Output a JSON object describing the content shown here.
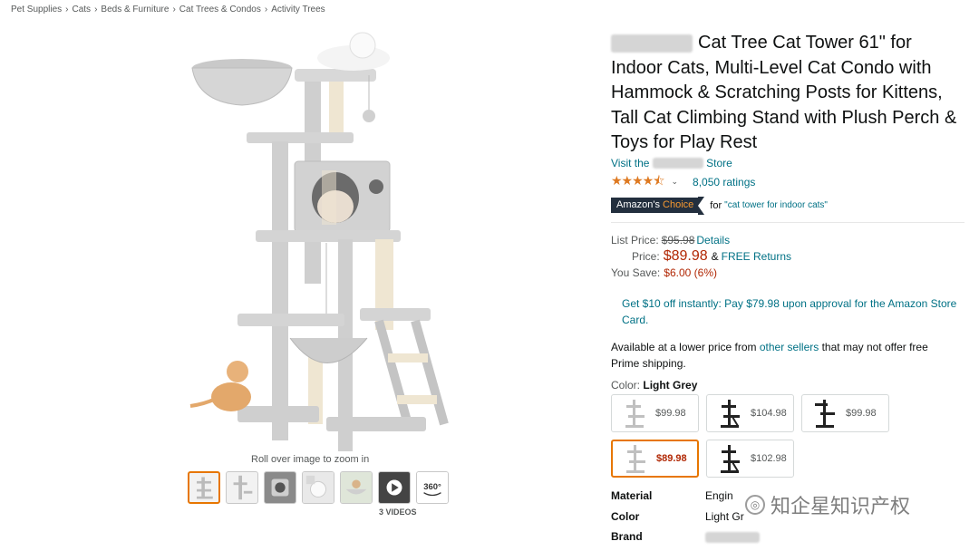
{
  "breadcrumb": [
    "Pet Supplies",
    "Cats",
    "Beds & Furniture",
    "Cat Trees & Condos",
    "Activity Trees"
  ],
  "breadcrumb_sep": "›",
  "gallery": {
    "zoom_hint": "Roll over image to zoom in",
    "videos_label": "3 VIDEOS",
    "thumb_360_label": "360°",
    "thumbnails": [
      "image-1",
      "image-2",
      "image-3",
      "image-4",
      "image-5",
      "video",
      "360-view"
    ]
  },
  "product": {
    "title": "Cat Tree Cat Tower 61\" for Indoor Cats, Multi-Level Cat Condo with Hammock & Scratching Posts for Kittens, Tall Cat Climbing Stand with Plush Perch & Toys for Play Rest",
    "store_prefix": "Visit the",
    "store_suffix": "Store",
    "stars": "★★★★⯪",
    "rating_chevron": "⌄",
    "ratings": "8,050 ratings",
    "badge_a": "Amazon's",
    "badge_b": "Choice",
    "badge_for": "for",
    "badge_keyword": "\"cat tower for indoor cats\""
  },
  "pricing": {
    "list_label": "List Price:",
    "list_price": "$95.98",
    "details": "Details",
    "price_label": "Price:",
    "price": "$89.98",
    "amp": "&",
    "free_returns": "FREE Returns",
    "save_label": "You Save:",
    "save_value": "$6.00 (6%)"
  },
  "promo": "Get $10 off instantly: Pay $79.98 upon approval for the Amazon Store Card.",
  "lower_offer": {
    "pre": "Available at a lower price from",
    "link": "other sellers",
    "post": "that may not offer free Prime shipping."
  },
  "color": {
    "label": "Color:",
    "value": "Light Grey"
  },
  "swatches": [
    {
      "price": "$99.98",
      "selected": false,
      "tone": "grey"
    },
    {
      "price": "$104.98",
      "selected": false,
      "tone": "black"
    },
    {
      "price": "$99.98",
      "selected": false,
      "tone": "black"
    },
    {
      "price": "$89.98",
      "selected": true,
      "tone": "grey"
    },
    {
      "price": "$102.98",
      "selected": false,
      "tone": "black"
    }
  ],
  "specs": [
    {
      "key": "Material",
      "value": "Engin"
    },
    {
      "key": "Color",
      "value": "Light Gr"
    },
    {
      "key": "Brand",
      "value": ""
    }
  ],
  "watermark": "知企星知识产权",
  "colors": {
    "link": "#007185",
    "price": "#b12704",
    "star": "#de7921",
    "badge_bg": "#232f3e",
    "badge_accent": "#f69931",
    "selected_border": "#e77600"
  }
}
